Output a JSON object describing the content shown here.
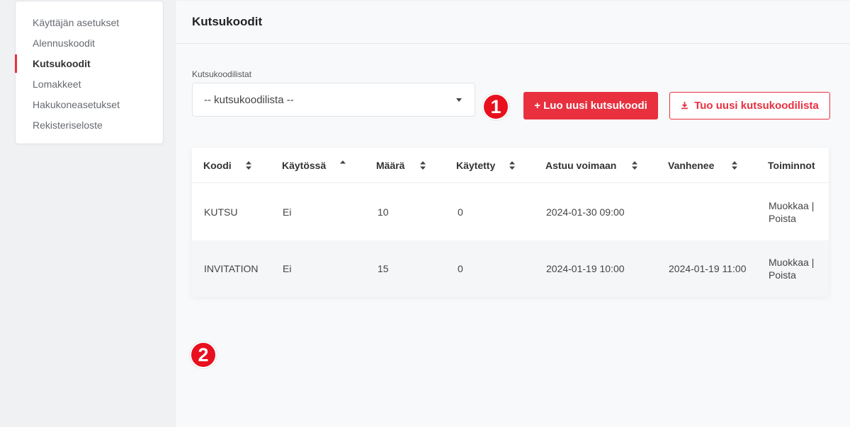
{
  "sidebar": {
    "items": [
      {
        "label": "Käyttäjän asetukset"
      },
      {
        "label": "Alennuskoodit"
      },
      {
        "label": "Kutsukoodit"
      },
      {
        "label": "Lomakkeet"
      },
      {
        "label": "Hakukoneasetukset"
      },
      {
        "label": "Rekisteriseloste"
      }
    ],
    "active_index": 2
  },
  "page": {
    "title": "Kutsukoodit"
  },
  "list_select": {
    "label": "Kutsukoodilistat",
    "value": "-- kutsukoodilista --"
  },
  "markers": {
    "first": "1",
    "second": "2"
  },
  "buttons": {
    "create": "+ Luo uusi kutsukoodi",
    "import": "Tuo uusi kutsukoodilista"
  },
  "table": {
    "columns": [
      "Koodi",
      "Käytössä",
      "Määrä",
      "Käytetty",
      "Astuu voimaan",
      "Vanhenee",
      "Toiminnot"
    ],
    "rows": [
      {
        "code": "KUTSU",
        "active": "Ei",
        "amount": "10",
        "used": "0",
        "start": "2024-01-30 09:00",
        "expires": "",
        "edit": "Muokkaa |",
        "delete": "Poista"
      },
      {
        "code": "INVITATION",
        "active": "Ei",
        "amount": "15",
        "used": "0",
        "start": "2024-01-19 10:00",
        "expires": "2024-01-19 11:00",
        "edit": "Muokkaa |",
        "delete": "Poista"
      }
    ]
  },
  "colors": {
    "accent": "#e8303f",
    "marker": "#e8101e"
  },
  "icons": {
    "sort": "sort-both-icon",
    "sort_asc": "sort-asc-icon",
    "download": "download-icon",
    "caret": "caret-down-icon"
  }
}
